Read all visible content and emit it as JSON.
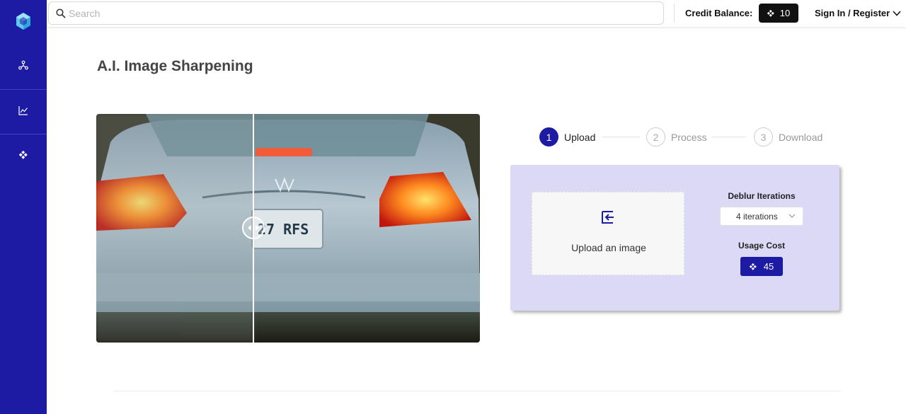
{
  "topbar": {
    "search_placeholder": "Search",
    "credit_label": "Credit Balance:",
    "credit_value": "10",
    "signin_label": "Sign In / Register"
  },
  "sidebar": {
    "items": [
      {
        "icon": "network-icon"
      },
      {
        "icon": "chart-line-icon"
      },
      {
        "icon": "credits-diamond-icon"
      }
    ]
  },
  "main": {
    "title": "A.I. Image Sharpening"
  },
  "stepper": {
    "steps": [
      {
        "number": "1",
        "label": "Upload",
        "state": "active"
      },
      {
        "number": "2",
        "label": "Process",
        "state": "inactive"
      },
      {
        "number": "3",
        "label": "Download",
        "state": "inactive"
      }
    ]
  },
  "panel": {
    "upload_text": "Upload an image",
    "deblur_label": "Deblur Iterations",
    "deblur_value": "4 iterations",
    "cost_label": "Usage Cost",
    "cost_value": "45"
  },
  "preview": {
    "plate_text": "27 RFS"
  },
  "colors": {
    "brand": "#1d1aa3",
    "panel_bg": "#dcd9f6",
    "credit_badge": "#111111"
  }
}
